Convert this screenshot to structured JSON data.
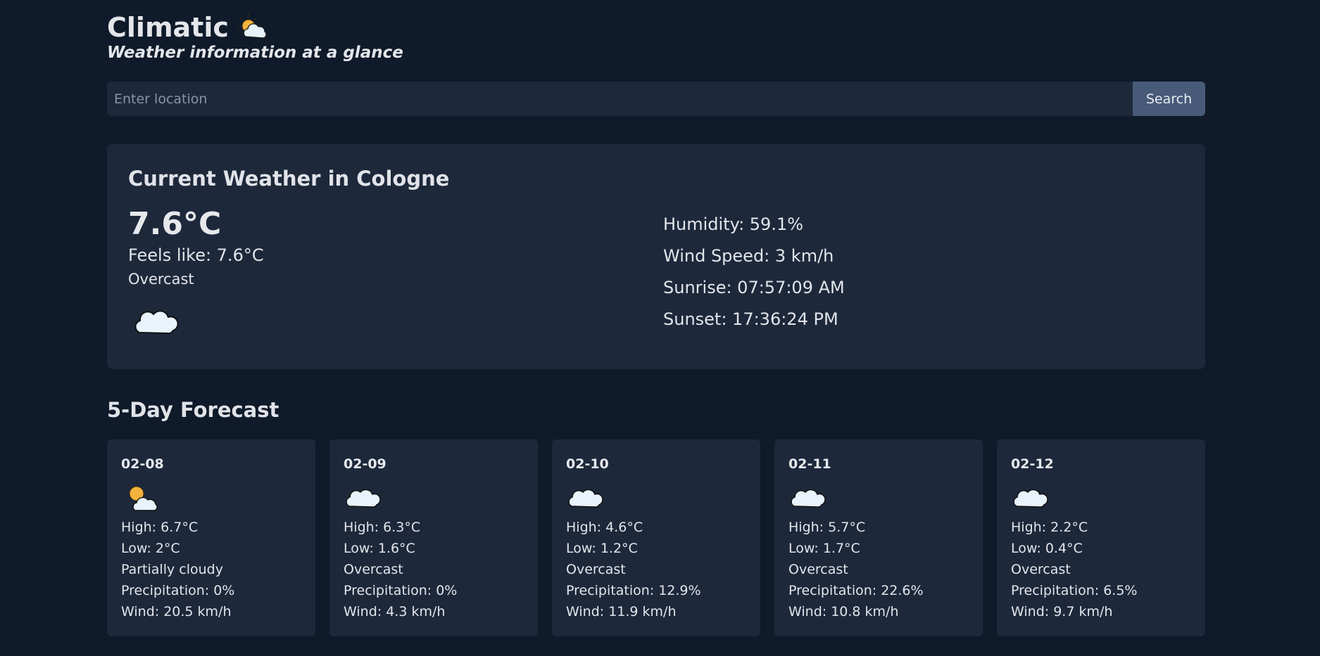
{
  "app": {
    "title": "Climatic",
    "title_icon": "sun-behind-cloud-icon",
    "subtitle": "Weather information at a glance"
  },
  "search": {
    "placeholder": "Enter location",
    "value": "",
    "button_label": "Search"
  },
  "current": {
    "heading": "Current Weather in Cologne",
    "temperature": "7.6°C",
    "feels_like": "Feels like: 7.6°C",
    "condition": "Overcast",
    "icon": "cloud-icon",
    "humidity": "Humidity: 59.1%",
    "wind": "Wind Speed: 3 km/h",
    "sunrise": "Sunrise: 07:57:09 AM",
    "sunset": "Sunset: 17:36:24 PM"
  },
  "forecast": {
    "heading": "5-Day Forecast",
    "days": [
      {
        "date": "02-08",
        "icon": "sun-behind-cloud-icon",
        "high": "High: 6.7°C",
        "low": "Low: 2°C",
        "condition": "Partially cloudy",
        "precip": "Precipitation: 0%",
        "wind": "Wind: 20.5 km/h"
      },
      {
        "date": "02-09",
        "icon": "cloud-icon",
        "high": "High: 6.3°C",
        "low": "Low: 1.6°C",
        "condition": "Overcast",
        "precip": "Precipitation: 0%",
        "wind": "Wind: 4.3 km/h"
      },
      {
        "date": "02-10",
        "icon": "cloud-icon",
        "high": "High: 4.6°C",
        "low": "Low: 1.2°C",
        "condition": "Overcast",
        "precip": "Precipitation: 12.9%",
        "wind": "Wind: 11.9 km/h"
      },
      {
        "date": "02-11",
        "icon": "cloud-icon",
        "high": "High: 5.7°C",
        "low": "Low: 1.7°C",
        "condition": "Overcast",
        "precip": "Precipitation: 22.6%",
        "wind": "Wind: 10.8 km/h"
      },
      {
        "date": "02-12",
        "icon": "cloud-icon",
        "high": "High: 2.2°C",
        "low": "Low: 0.4°C",
        "condition": "Overcast",
        "precip": "Precipitation: 6.5%",
        "wind": "Wind: 9.7 km/h"
      }
    ]
  },
  "colors": {
    "background": "#0f1a2a",
    "card": "#1d283b",
    "button": "#475a78",
    "text": "#e2e5ea",
    "sun": "#f4b33c",
    "cloud": "#e8f3fb"
  }
}
